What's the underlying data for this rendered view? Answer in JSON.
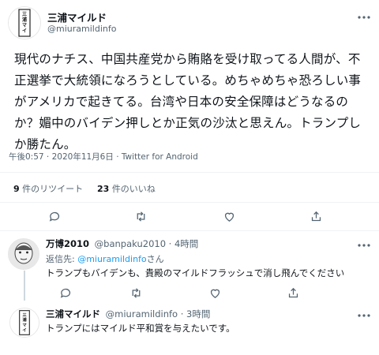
{
  "main_tweet": {
    "author_name": "三浦マイルド",
    "handle": "@miuramildinfo",
    "text": "現代のナチス、中国共産党から賄賂を受け取ってる人間が、不正選挙で大統領になろうとしている。めちゃめちゃ恐ろしい事がアメリカで起きてる。台湾や日本の安全保障はどうなるのか？媚中のバイデン押しとか正気の沙汰と思えん。トランプしか勝たん。",
    "timestamp": "午後0:57 · 2020年11月6日 · Twitter for Android",
    "retweet_count": "9",
    "retweet_label": "件のリツイート",
    "like_count": "23",
    "like_label": "件のいいね"
  },
  "reply1": {
    "author_name": "万博2010",
    "handle_time": "@banpaku2010 · 4時間",
    "reply_to_prefix": "返信先: ",
    "reply_to_handle": "@miuramildinfo",
    "reply_to_suffix": "さん",
    "text": "トランプもバイデンも、貴殿のマイルドフラッシュで消し飛んでください"
  },
  "reply2": {
    "author_name": "三浦マイルド",
    "handle_time": "@miuramildinfo · 3時間",
    "text": "トランプにはマイルド平和賞を与えたいです。"
  },
  "avatar_text": "三浦マイルド",
  "icons": [
    "more-icon",
    "reply-icon",
    "retweet-icon",
    "like-icon",
    "share-icon"
  ],
  "colors": {
    "link": "#1d9bf0",
    "muted": "#536471",
    "divider": "#eff3f4"
  }
}
